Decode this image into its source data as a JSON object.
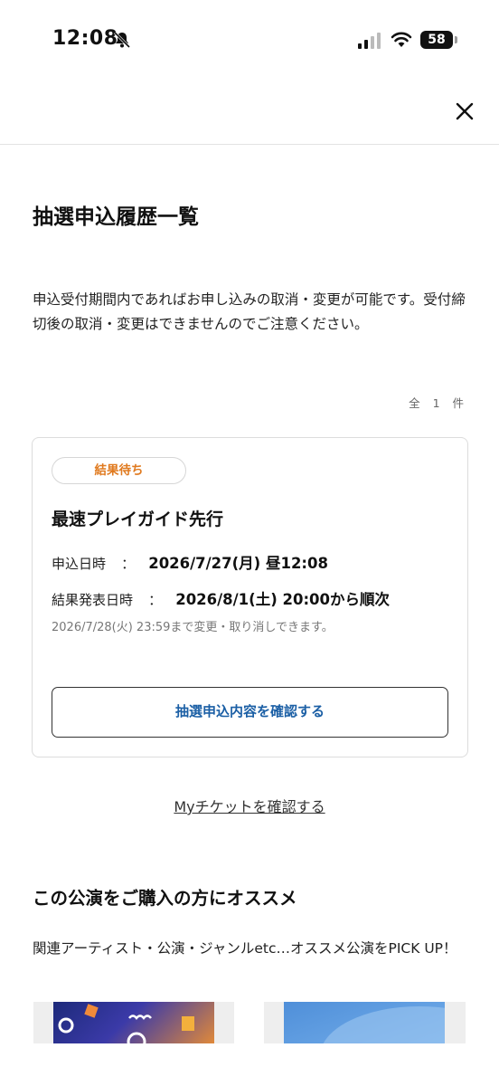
{
  "status_bar": {
    "time": "12:08",
    "battery": "58",
    "icons": [
      "bell-slash-icon",
      "signal-icon",
      "wifi-icon",
      "battery-icon"
    ]
  },
  "header": {
    "close_icon": "close-icon"
  },
  "page": {
    "title": "抽選申込履歴一覧",
    "notice": "申込受付期間内であればお申し込みの取消・変更が可能です。受付締切後の取消・変更はできませんのでご注意ください。",
    "count": "全 1 件"
  },
  "entry": {
    "status": "結果待ち",
    "status_color": "#e07a1f",
    "name": "最速プレイガイド先行",
    "applied_label": "申込日時",
    "applied_sep": "：",
    "applied_value": "2026/7/27(月) 昼12:08",
    "result_label": "結果発表日時",
    "result_sep": "：",
    "result_value": "2026/8/1(土) 20:00から順次",
    "deadline_note": "2026/7/28(火) 23:59まで変更・取り消しできます。",
    "confirm_button": "抽選申込内容を確認する"
  },
  "links": {
    "my_ticket": "Myチケットを確認する"
  },
  "recommend": {
    "title": "この公演をご購入の方にオススメ",
    "description": "関連アーティスト・公演・ジャンルetc…オススメ公演をPICK UP！"
  },
  "colors": {
    "accent_link": "#1b5fa5",
    "status_orange": "#e07a1f"
  }
}
